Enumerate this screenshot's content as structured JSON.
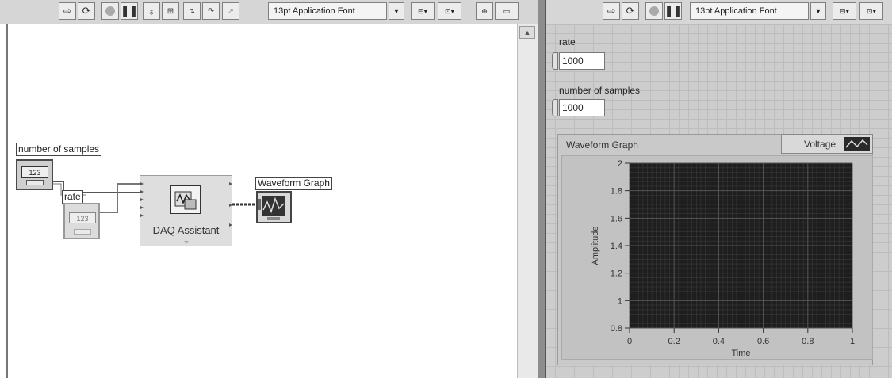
{
  "left_toolbar": {
    "font_selector": "13pt Application Font",
    "icons": [
      "run-arrow-icon",
      "run-continuous-icon",
      "abort-icon",
      "pause-icon",
      "highlight-bulb-icon",
      "retain-wire-icon",
      "step-into-icon",
      "step-over-icon",
      "step-out-icon"
    ]
  },
  "right_toolbar": {
    "font_selector": "13pt Application Font",
    "icons": [
      "run-arrow-icon",
      "run-continuous-icon",
      "abort-icon",
      "pause-icon"
    ]
  },
  "block_diagram": {
    "number_of_samples_label": "number of samples",
    "rate_label": "rate",
    "numeric_terminal_text": "123",
    "daq_label": "DAQ Assistant",
    "waveform_graph_label": "Waveform Graph"
  },
  "front_panel": {
    "rate": {
      "label": "rate",
      "value": "1000"
    },
    "number_of_samples": {
      "label": "number of samples",
      "value": "1000"
    },
    "graph": {
      "title": "Waveform Graph",
      "legend_series": "Voltage",
      "colors": {
        "plot_bg": "#1e1e1e",
        "grid": "#555555"
      }
    }
  },
  "chart_data": {
    "type": "line",
    "title": "Waveform Graph",
    "xlabel": "Time",
    "ylabel": "Amplitude",
    "xlim": [
      0,
      1
    ],
    "ylim": [
      0.8,
      2
    ],
    "x_ticks": [
      "0",
      "0.2",
      "0.4",
      "0.6",
      "0.8",
      "1"
    ],
    "y_ticks": [
      "0.8",
      "1",
      "1.2",
      "1.4",
      "1.6",
      "1.8",
      "2"
    ],
    "grid": true,
    "legend_position": "top-right",
    "series": [
      {
        "name": "Voltage",
        "x": [],
        "y": []
      }
    ]
  }
}
